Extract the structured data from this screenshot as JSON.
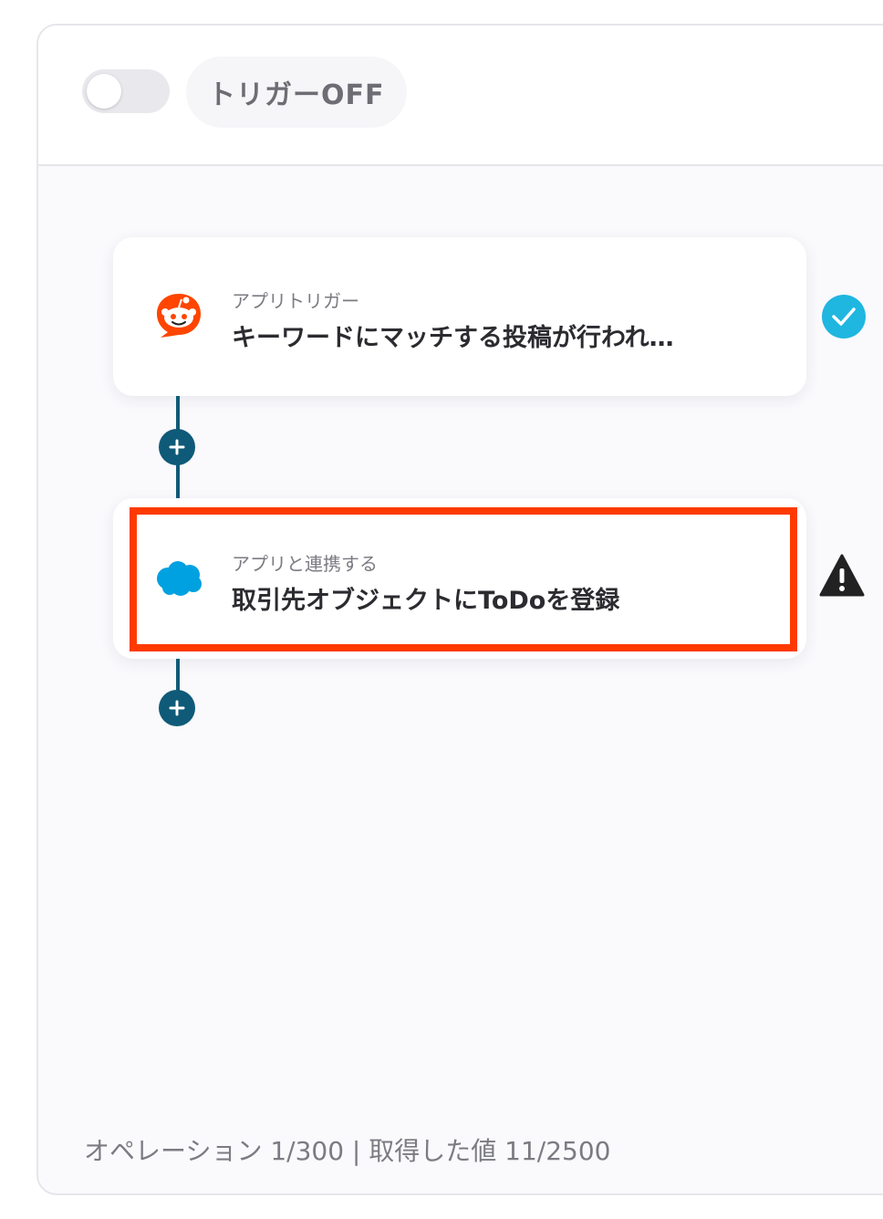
{
  "header": {
    "toggle_state": "off",
    "trigger_label": "トリガーOFF"
  },
  "flow": {
    "steps": [
      {
        "app_icon": "reddit-icon",
        "subtitle": "アプリトリガー",
        "title": "キーワードにマッチする投稿が行われ…",
        "status": "check-icon",
        "status_color": "#1fb6e0"
      },
      {
        "app_icon": "salesforce-icon",
        "subtitle": "アプリと連携する",
        "title": "取引先オブジェクトにToDoを登録",
        "status": "warning-icon",
        "status_color": "#222222"
      }
    ]
  },
  "footer": {
    "usage": "オペレーション 1/300 | 取得した値 11/2500"
  },
  "colors": {
    "accent": "#0f5a78",
    "highlight": "#ff3a00",
    "reddit": "#ff4500",
    "salesforce": "#00a1e0"
  }
}
